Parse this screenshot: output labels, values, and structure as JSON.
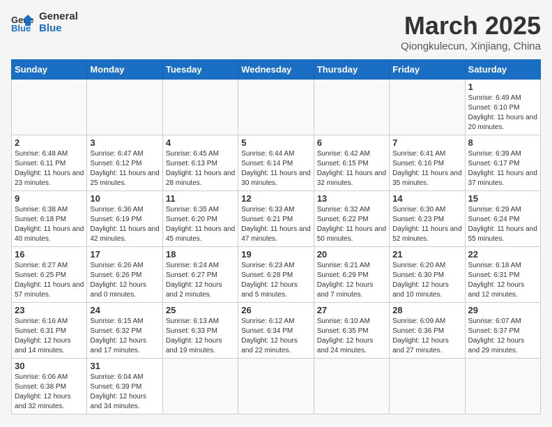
{
  "logo": {
    "line1": "General",
    "line2": "Blue"
  },
  "title": "March 2025",
  "location": "Qiongkulecun, Xinjiang, China",
  "days_of_week": [
    "Sunday",
    "Monday",
    "Tuesday",
    "Wednesday",
    "Thursday",
    "Friday",
    "Saturday"
  ],
  "weeks": [
    [
      {
        "day": "",
        "info": ""
      },
      {
        "day": "",
        "info": ""
      },
      {
        "day": "",
        "info": ""
      },
      {
        "day": "",
        "info": ""
      },
      {
        "day": "",
        "info": ""
      },
      {
        "day": "",
        "info": ""
      },
      {
        "day": "1",
        "info": "Sunrise: 6:49 AM\nSunset: 6:10 PM\nDaylight: 11 hours and 20 minutes."
      }
    ],
    [
      {
        "day": "2",
        "info": "Sunrise: 6:48 AM\nSunset: 6:11 PM\nDaylight: 11 hours and 23 minutes."
      },
      {
        "day": "3",
        "info": "Sunrise: 6:47 AM\nSunset: 6:12 PM\nDaylight: 11 hours and 25 minutes."
      },
      {
        "day": "4",
        "info": "Sunrise: 6:45 AM\nSunset: 6:13 PM\nDaylight: 11 hours and 28 minutes."
      },
      {
        "day": "5",
        "info": "Sunrise: 6:44 AM\nSunset: 6:14 PM\nDaylight: 11 hours and 30 minutes."
      },
      {
        "day": "6",
        "info": "Sunrise: 6:42 AM\nSunset: 6:15 PM\nDaylight: 11 hours and 32 minutes."
      },
      {
        "day": "7",
        "info": "Sunrise: 6:41 AM\nSunset: 6:16 PM\nDaylight: 11 hours and 35 minutes."
      },
      {
        "day": "8",
        "info": "Sunrise: 6:39 AM\nSunset: 6:17 PM\nDaylight: 11 hours and 37 minutes."
      }
    ],
    [
      {
        "day": "9",
        "info": "Sunrise: 6:38 AM\nSunset: 6:18 PM\nDaylight: 11 hours and 40 minutes."
      },
      {
        "day": "10",
        "info": "Sunrise: 6:36 AM\nSunset: 6:19 PM\nDaylight: 11 hours and 42 minutes."
      },
      {
        "day": "11",
        "info": "Sunrise: 6:35 AM\nSunset: 6:20 PM\nDaylight: 11 hours and 45 minutes."
      },
      {
        "day": "12",
        "info": "Sunrise: 6:33 AM\nSunset: 6:21 PM\nDaylight: 11 hours and 47 minutes."
      },
      {
        "day": "13",
        "info": "Sunrise: 6:32 AM\nSunset: 6:22 PM\nDaylight: 11 hours and 50 minutes."
      },
      {
        "day": "14",
        "info": "Sunrise: 6:30 AM\nSunset: 6:23 PM\nDaylight: 11 hours and 52 minutes."
      },
      {
        "day": "15",
        "info": "Sunrise: 6:29 AM\nSunset: 6:24 PM\nDaylight: 11 hours and 55 minutes."
      }
    ],
    [
      {
        "day": "16",
        "info": "Sunrise: 6:27 AM\nSunset: 6:25 PM\nDaylight: 11 hours and 57 minutes."
      },
      {
        "day": "17",
        "info": "Sunrise: 6:26 AM\nSunset: 6:26 PM\nDaylight: 12 hours and 0 minutes."
      },
      {
        "day": "18",
        "info": "Sunrise: 6:24 AM\nSunset: 6:27 PM\nDaylight: 12 hours and 2 minutes."
      },
      {
        "day": "19",
        "info": "Sunrise: 6:23 AM\nSunset: 6:28 PM\nDaylight: 12 hours and 5 minutes."
      },
      {
        "day": "20",
        "info": "Sunrise: 6:21 AM\nSunset: 6:29 PM\nDaylight: 12 hours and 7 minutes."
      },
      {
        "day": "21",
        "info": "Sunrise: 6:20 AM\nSunset: 6:30 PM\nDaylight: 12 hours and 10 minutes."
      },
      {
        "day": "22",
        "info": "Sunrise: 6:18 AM\nSunset: 6:31 PM\nDaylight: 12 hours and 12 minutes."
      }
    ],
    [
      {
        "day": "23",
        "info": "Sunrise: 6:16 AM\nSunset: 6:31 PM\nDaylight: 12 hours and 14 minutes."
      },
      {
        "day": "24",
        "info": "Sunrise: 6:15 AM\nSunset: 6:32 PM\nDaylight: 12 hours and 17 minutes."
      },
      {
        "day": "25",
        "info": "Sunrise: 6:13 AM\nSunset: 6:33 PM\nDaylight: 12 hours and 19 minutes."
      },
      {
        "day": "26",
        "info": "Sunrise: 6:12 AM\nSunset: 6:34 PM\nDaylight: 12 hours and 22 minutes."
      },
      {
        "day": "27",
        "info": "Sunrise: 6:10 AM\nSunset: 6:35 PM\nDaylight: 12 hours and 24 minutes."
      },
      {
        "day": "28",
        "info": "Sunrise: 6:09 AM\nSunset: 6:36 PM\nDaylight: 12 hours and 27 minutes."
      },
      {
        "day": "29",
        "info": "Sunrise: 6:07 AM\nSunset: 6:37 PM\nDaylight: 12 hours and 29 minutes."
      }
    ],
    [
      {
        "day": "30",
        "info": "Sunrise: 6:06 AM\nSunset: 6:38 PM\nDaylight: 12 hours and 32 minutes."
      },
      {
        "day": "31",
        "info": "Sunrise: 6:04 AM\nSunset: 6:39 PM\nDaylight: 12 hours and 34 minutes."
      },
      {
        "day": "",
        "info": ""
      },
      {
        "day": "",
        "info": ""
      },
      {
        "day": "",
        "info": ""
      },
      {
        "day": "",
        "info": ""
      },
      {
        "day": "",
        "info": ""
      }
    ]
  ]
}
